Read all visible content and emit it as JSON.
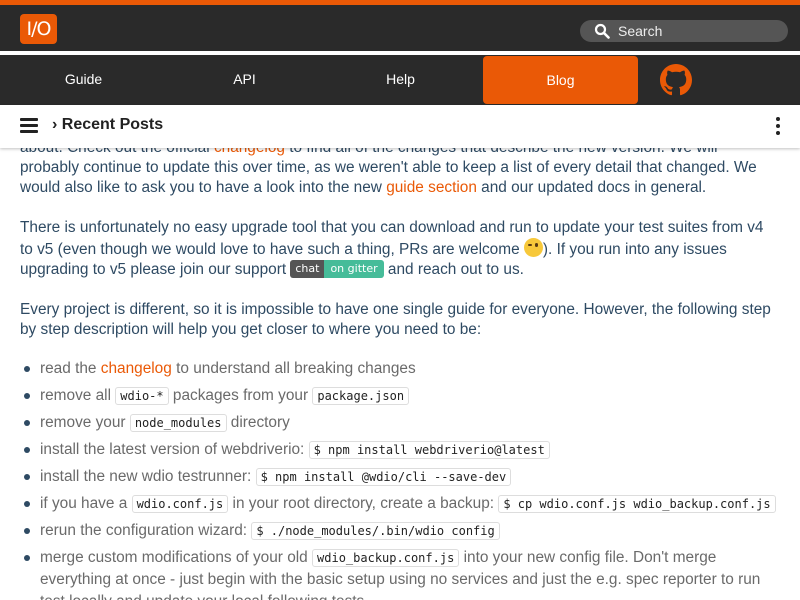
{
  "brand": {
    "logo_text": "I/O",
    "accent": "#ea5906",
    "bar_color": "#2a2a2a"
  },
  "search": {
    "placeholder": "Search",
    "icon": "search-icon"
  },
  "nav": {
    "items": [
      {
        "label": "Guide"
      },
      {
        "label": "API"
      },
      {
        "label": "Help"
      },
      {
        "label": "Blog",
        "active": true
      }
    ],
    "github_icon": "github-icon"
  },
  "subnav": {
    "menu_icon": "hamburger-icon",
    "breadcrumb": "› Recent Posts",
    "more_icon": "kebab-icon"
  },
  "article": {
    "p1": {
      "t1": "about. Check out the official ",
      "link1": "changelog",
      "t2": " to find all of the changes that describe the new version. We will probably continue to update this over time, as we weren't able to keep a list of every detail that changed. We would also like to ask you to have a look into the new ",
      "link2": "guide section",
      "t3": " and our updated docs in general."
    },
    "p2": {
      "t1": "There is unfortunately no easy upgrade tool that you can download and run to update your test suites from v4 to v5 (even though we would love to have such a thing, PRs are welcome ",
      "t2": "). If you run into any issues upgrading to v5 please join our support ",
      "badge_left": "chat",
      "badge_right": "on gitter",
      "t3": " and reach out to us."
    },
    "p3": "Every project is different, so it is impossible to have one single guide for everyone. However, the following step by step description will help you get closer to where you need to be:",
    "steps": {
      "s1": {
        "t1": "read the ",
        "link": "changelog",
        "t2": " to understand all breaking changes"
      },
      "s2": {
        "t1": "remove all ",
        "c1": "wdio-*",
        "t2": " packages from your ",
        "c2": "package.json"
      },
      "s3": {
        "t1": "remove your ",
        "c1": "node_modules",
        "t2": " directory"
      },
      "s4": {
        "t1": "install the latest version of webdriverio: ",
        "c1": "$ npm install webdriverio@latest"
      },
      "s5": {
        "t1": "install the new wdio testrunner: ",
        "c1": "$ npm install @wdio/cli --save-dev"
      },
      "s6": {
        "t1": "if you have a ",
        "c1": "wdio.conf.js",
        "t2": " in your root directory, create a backup: ",
        "c2": "$ cp wdio.conf.js wdio_backup.conf.js"
      },
      "s7": {
        "t1": "rerun the configuration wizard: ",
        "c1": "$ ./node_modules/.bin/wdio config"
      },
      "s8": {
        "t1": "merge custom modifications of your old ",
        "c1": "wdio_backup.conf.js",
        "t2": " into your new config file. Don't merge everything at once - just begin with the basic setup using no services and just the e.g. spec reporter to run test locally and update your local following tests"
      }
    }
  }
}
